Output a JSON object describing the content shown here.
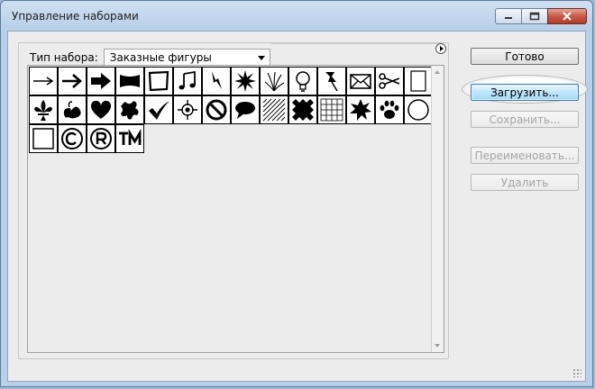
{
  "window": {
    "title": "Управление наборами"
  },
  "set_type": {
    "label": "Тип набора:",
    "selected": "Заказные фигуры"
  },
  "buttons": {
    "done": "Готово",
    "load": "Загрузить...",
    "save": "Сохранить...",
    "rename": "Переименовать...",
    "delete": "Удалить"
  },
  "shapes": [
    {
      "icon": "arrow-thin-icon"
    },
    {
      "icon": "arrow-medium-icon"
    },
    {
      "icon": "arrow-bold-icon"
    },
    {
      "icon": "banner-icon"
    },
    {
      "icon": "frame-icon"
    },
    {
      "icon": "music-note-icon"
    },
    {
      "icon": "lightning-icon"
    },
    {
      "icon": "starburst-icon"
    },
    {
      "icon": "grass-icon"
    },
    {
      "icon": "lightbulb-icon"
    },
    {
      "icon": "thumbtack-icon"
    },
    {
      "icon": "envelope-icon"
    },
    {
      "icon": "scissors-icon"
    },
    {
      "icon": "blank-page-icon"
    },
    {
      "icon": "fleur-de-lis-icon"
    },
    {
      "icon": "ornament-icon"
    },
    {
      "icon": "heart-icon"
    },
    {
      "icon": "splat-icon"
    },
    {
      "icon": "checkmark-icon"
    },
    {
      "icon": "target-icon"
    },
    {
      "icon": "no-symbol-icon"
    },
    {
      "icon": "speech-bubble-icon"
    },
    {
      "icon": "hatch-pattern-icon"
    },
    {
      "icon": "diamond-pattern-icon"
    },
    {
      "icon": "grid-pattern-icon"
    },
    {
      "icon": "burst-icon"
    },
    {
      "icon": "paw-print-icon"
    },
    {
      "icon": "circle-icon"
    },
    {
      "icon": "square-icon"
    },
    {
      "icon": "copyright-icon"
    },
    {
      "icon": "registered-icon"
    },
    {
      "icon": "trademark-icon"
    }
  ]
}
